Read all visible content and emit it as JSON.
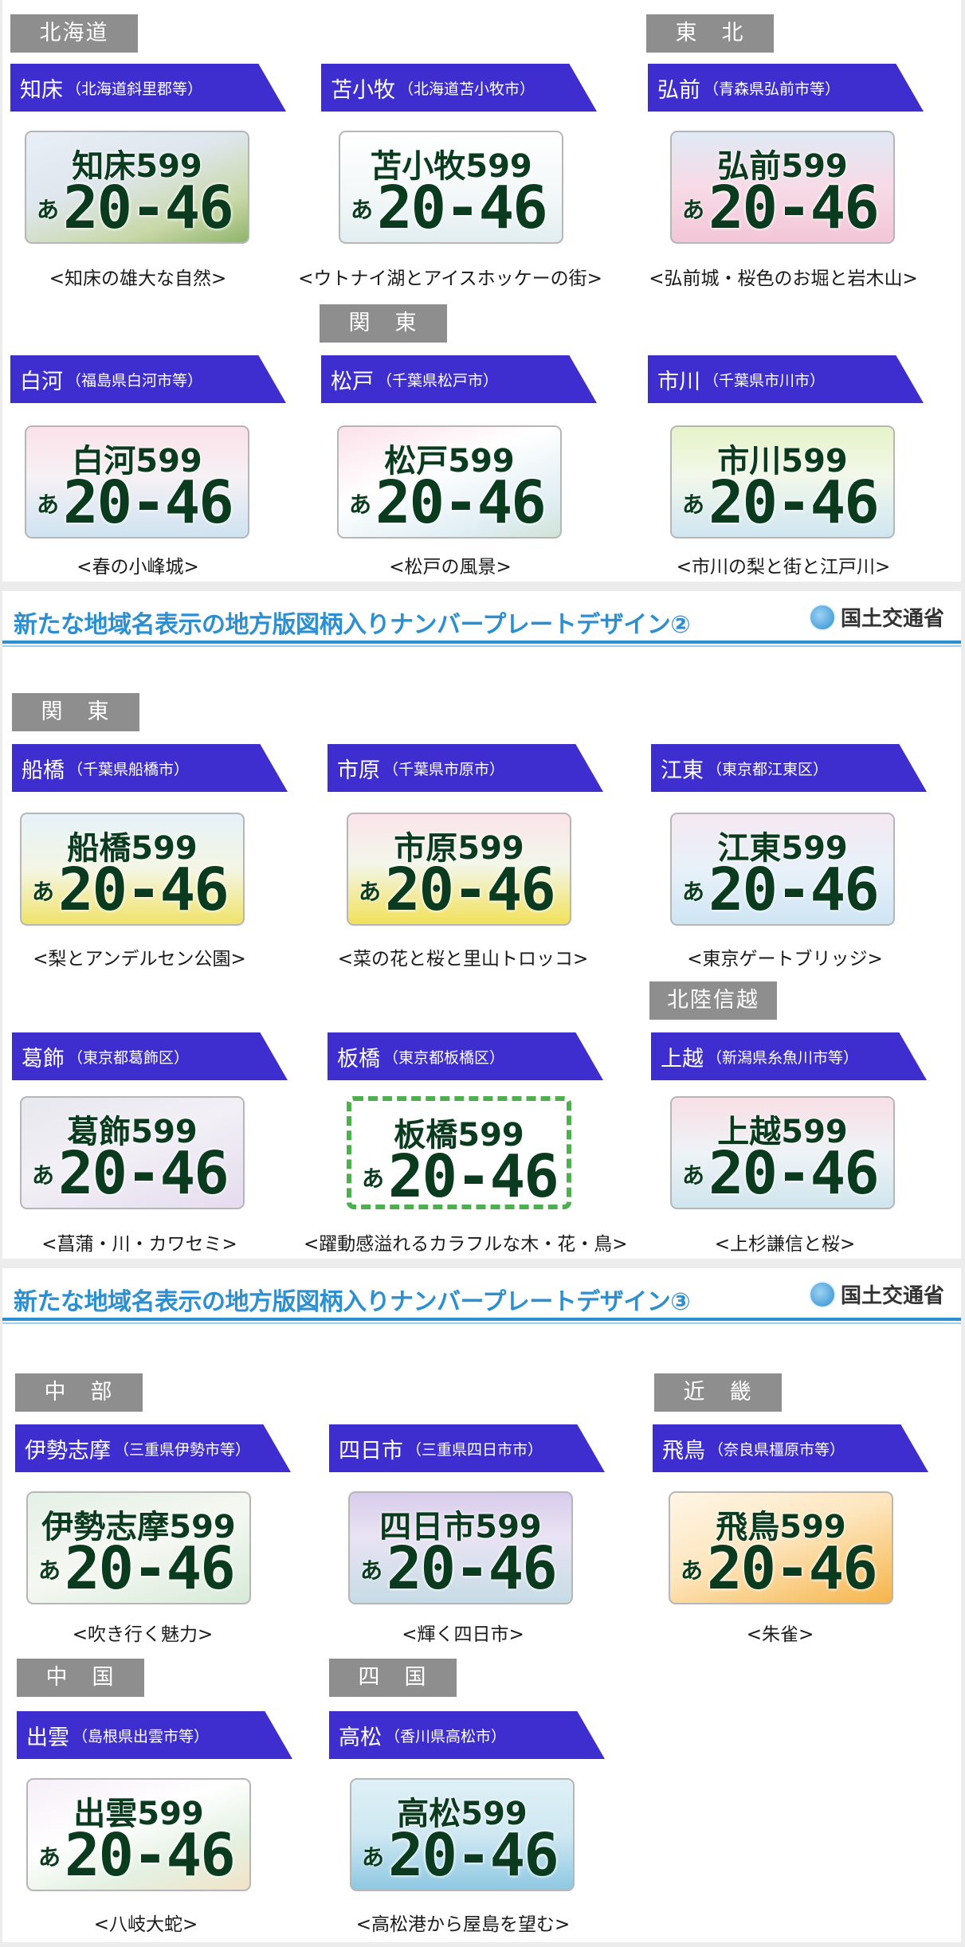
{
  "banner": {
    "title_2": "新たな地域名表示の地方版図柄入りナンバープレートデザイン②",
    "title_3": "新たな地域名表示の地方版図柄入りナンバープレートデザイン③",
    "ministry": "国土交通省"
  },
  "regions": {
    "hokkaido": "北海道",
    "tohoku": "東　北",
    "kanto": "関　東",
    "kanto2": "関　東",
    "hokuriku": "北陸信越",
    "chubu": "中　部",
    "kinki": "近　畿",
    "chugoku": "中　国",
    "shikoku": "四　国"
  },
  "plate": {
    "number": "20-46",
    "kana": "あ",
    "class": "599"
  },
  "colors": {
    "city_bar": "#3f2ecf",
    "region_tag": "#8e8e8e",
    "banner_text": "#2d8fd0",
    "plate_text": "#0b3b1e"
  },
  "plates": [
    {
      "name": "知床",
      "location": "（北海道斜里郡等）",
      "code": "知床599",
      "caption": "<知床の雄大な自然>"
    },
    {
      "name": "苫小牧",
      "location": "（北海道苫小牧市）",
      "code": "苫小牧599",
      "caption": "<ウトナイ湖とアイスホッケーの街>"
    },
    {
      "name": "弘前",
      "location": "（青森県弘前市等）",
      "code": "弘前599",
      "caption": "<弘前城・桜色のお堀と岩木山>"
    },
    {
      "name": "白河",
      "location": "（福島県白河市等）",
      "code": "白河599",
      "caption": "<春の小峰城>"
    },
    {
      "name": "松戸",
      "location": "（千葉県松戸市）",
      "code": "松戸599",
      "caption": "<松戸の風景>"
    },
    {
      "name": "市川",
      "location": "（千葉県市川市）",
      "code": "市川599",
      "caption": "<市川の梨と街と江戸川>"
    },
    {
      "name": "船橋",
      "location": "（千葉県船橋市）",
      "code": "船橋599",
      "caption": "<梨とアンデルセン公園>"
    },
    {
      "name": "市原",
      "location": "（千葉県市原市）",
      "code": "市原599",
      "caption": "<菜の花と桜と里山トロッコ>"
    },
    {
      "name": "江東",
      "location": "（東京都江東区）",
      "code": "江東599",
      "caption": "<東京ゲートブリッジ>"
    },
    {
      "name": "葛飾",
      "location": "（東京都葛飾区）",
      "code": "葛飾599",
      "caption": "<菖蒲・川・カワセミ>"
    },
    {
      "name": "板橋",
      "location": "（東京都板橋区）",
      "code": "板橋599",
      "caption": "<躍動感溢れるカラフルな木・花・鳥>"
    },
    {
      "name": "上越",
      "location": "（新潟県糸魚川市等）",
      "code": "上越599",
      "caption": "<上杉謙信と桜>"
    },
    {
      "name": "伊勢志摩",
      "location": "（三重県伊勢市等）",
      "code": "伊勢志摩599",
      "caption": "<吹き行く魅力>"
    },
    {
      "name": "四日市",
      "location": "（三重県四日市市）",
      "code": "四日市599",
      "caption": "<輝く四日市>"
    },
    {
      "name": "飛鳥",
      "location": "（奈良県橿原市等）",
      "code": "飛鳥599",
      "caption": "<朱雀>"
    },
    {
      "name": "出雲",
      "location": "（島根県出雲市等）",
      "code": "出雲599",
      "caption": "<八岐大蛇>"
    },
    {
      "name": "高松",
      "location": "（香川県高松市）",
      "code": "高松599",
      "caption": "<高松港から屋島を望む>"
    }
  ]
}
